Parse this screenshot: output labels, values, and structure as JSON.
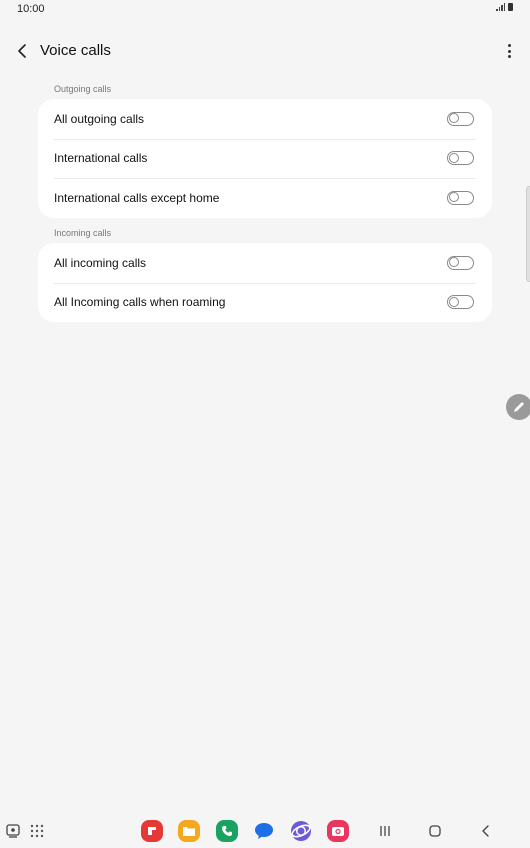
{
  "status_bar": {
    "time": "10:00"
  },
  "header": {
    "title": "Voice calls",
    "back_icon": "chevron-left-icon",
    "more_icon": "more-vertical-icon"
  },
  "sections": [
    {
      "title": "Outgoing calls",
      "items": [
        {
          "label": "All outgoing calls",
          "enabled": false
        },
        {
          "label": "International calls",
          "enabled": false
        },
        {
          "label": "International calls except home",
          "enabled": false
        }
      ]
    },
    {
      "title": "Incoming calls",
      "items": [
        {
          "label": "All incoming calls",
          "enabled": false
        },
        {
          "label": "All Incoming calls when roaming",
          "enabled": false
        }
      ]
    }
  ],
  "taskbar": {
    "apps": [
      "flipboard-icon",
      "my-files-icon",
      "phone-icon",
      "messages-icon",
      "internet-icon",
      "camera-icon"
    ],
    "nav": [
      "recents-icon",
      "home-icon",
      "back-icon"
    ],
    "colors": {
      "flipboard": "#e53935",
      "files": "#f4a81d",
      "phone": "#1aa260",
      "messages": "#1e6fe6",
      "internet": "#6b5bd6",
      "camera": "#e8365d"
    }
  }
}
